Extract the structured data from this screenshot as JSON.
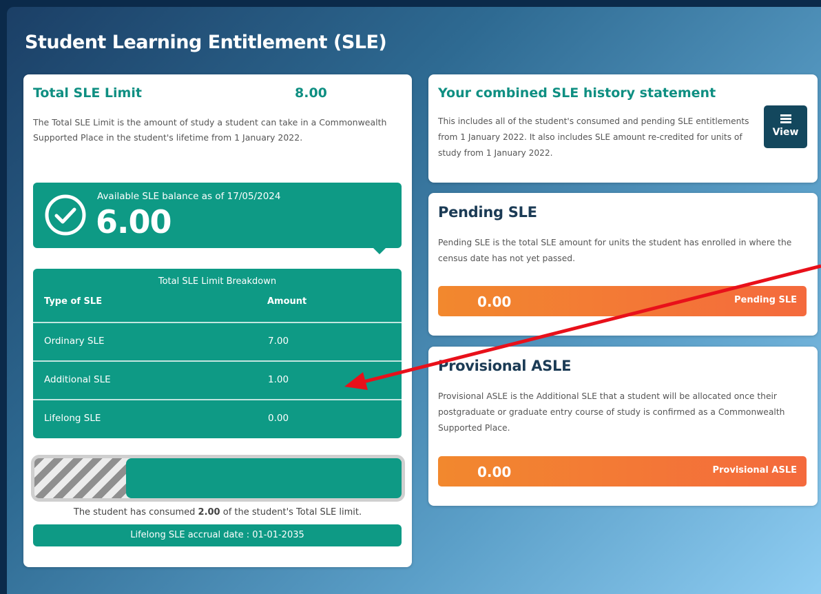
{
  "page": {
    "title": "Student Learning Entitlement (SLE)"
  },
  "total_limit": {
    "title": "Total SLE Limit",
    "value": "8.00",
    "description": "The Total SLE Limit is the amount of study a student can take in a Commonwealth Supported Place in the student's lifetime from 1 January 2022."
  },
  "balance": {
    "label": "Available SLE balance as of 17/05/2024",
    "value": "6.00"
  },
  "breakdown": {
    "title": "Total SLE Limit Breakdown",
    "col_type": "Type of SLE",
    "col_amount": "Amount",
    "rows": [
      {
        "name": "Ordinary SLE",
        "amount": "7.00"
      },
      {
        "name": "Additional SLE",
        "amount": "1.00"
      },
      {
        "name": "Lifelong SLE",
        "amount": "0.00"
      }
    ]
  },
  "usage": {
    "consumed_fraction": 0.25,
    "consumed_prefix": "The student has consumed ",
    "consumed_amount": "2.00",
    "consumed_suffix": " of the student's Total SLE limit.",
    "accrual": "Lifelong SLE accrual date : 01-01-2035"
  },
  "history": {
    "title": "Your combined SLE history statement",
    "description": "This includes all of the student's consumed and pending SLE entitlements from 1 January 2022. It also includes SLE amount re-credited for units of study from 1 January 2022.",
    "view_label": "View",
    "view_icon": "list-icon"
  },
  "pending": {
    "title": "Pending SLE",
    "description": "Pending SLE is the total SLE amount for units the student has enrolled in where the census date has not yet passed.",
    "value": "0.00",
    "label": "Pending SLE"
  },
  "provisional": {
    "title": "Provisional ASLE",
    "description": "Provisional ASLE is the Additional SLE that a student will be allocated once their postgraduate or graduate entry course of study is confirmed as a Commonwealth Supported Place.",
    "value": "0.00",
    "label": "Provisional ASLE"
  },
  "colors": {
    "teal": "#0e9a85",
    "orange_start": "#f2882e",
    "orange_end": "#f46a3d",
    "annotation_arrow": "#e8101a"
  }
}
